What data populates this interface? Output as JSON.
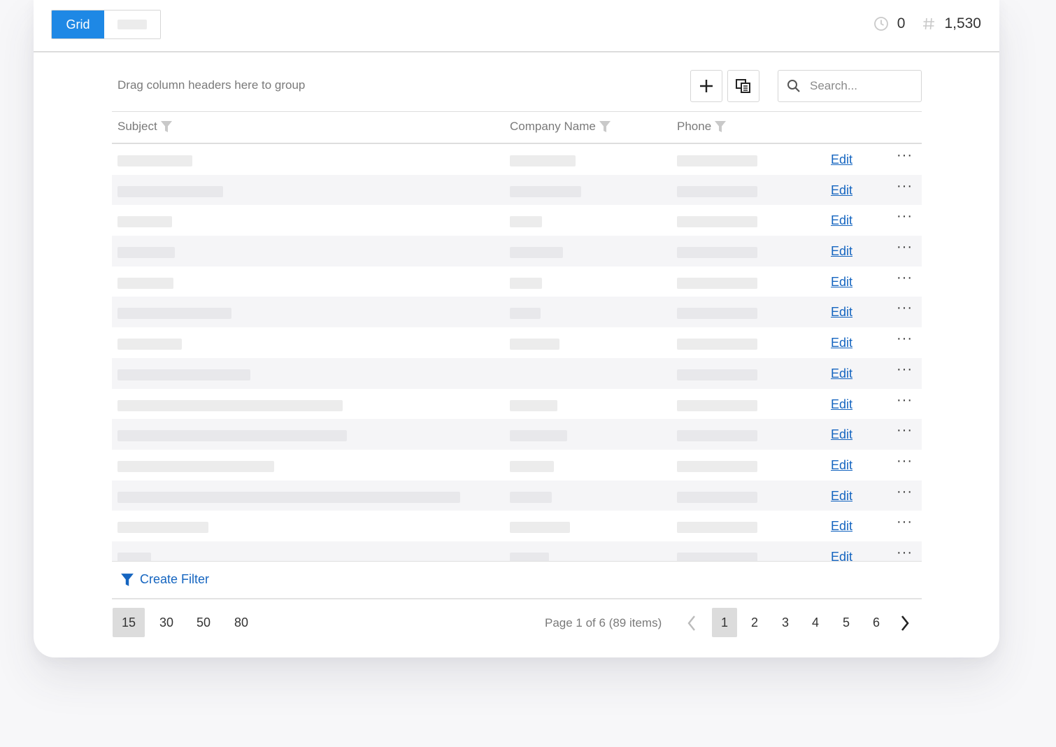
{
  "toolbar": {
    "view_tabs": [
      {
        "label": "Grid",
        "active": true
      },
      {
        "label": "",
        "active": false
      }
    ],
    "stats": [
      {
        "icon": "clock-icon",
        "value": "0"
      },
      {
        "icon": "hash-icon",
        "value": "1,530"
      }
    ]
  },
  "grid": {
    "group_hint": "Drag column headers here to group",
    "add_button_icon": "plus-icon",
    "column_chooser_icon": "column-chooser-icon",
    "search": {
      "placeholder": "Search...",
      "value": ""
    },
    "columns": [
      {
        "label": "Subject",
        "icon": "filter-icon"
      },
      {
        "label": "Company Name",
        "icon": "filter-icon"
      },
      {
        "label": "Phone",
        "icon": "filter-icon"
      }
    ],
    "row_actions": {
      "edit_label": "Edit",
      "more_label": "···"
    },
    "rows_loading": true,
    "create_filter_label": "Create Filter"
  },
  "pager": {
    "page_sizes": [
      "15",
      "30",
      "50",
      "80"
    ],
    "selected_page_size": "15",
    "info": "Page 1 of 6 (89 items)",
    "pages": [
      "1",
      "2",
      "3",
      "4",
      "5",
      "6"
    ],
    "current_page": "1"
  },
  "colors": {
    "accent": "#1e88e5",
    "link": "#1565c0",
    "placeholder_bar": "#ececec"
  }
}
